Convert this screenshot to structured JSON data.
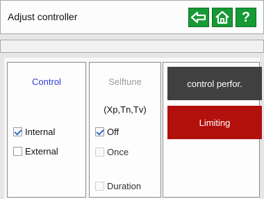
{
  "header": {
    "title": "Adjust controller",
    "buttons": [
      "back-arrow-icon",
      "home-icon",
      "help-icon"
    ],
    "help_glyph": "?"
  },
  "control_panel": {
    "title": "Control",
    "title_color": "#2b3fd6",
    "options": [
      {
        "label": "Internal",
        "checked": true
      },
      {
        "label": "External",
        "checked": false
      }
    ]
  },
  "selftune_panel": {
    "title": "Selftune",
    "subtitle": "(Xp,Tn,Tv)",
    "title_color": "#9c9c9c",
    "options": [
      {
        "label": "Off",
        "checked": true
      },
      {
        "label": "Once",
        "checked": false
      },
      {
        "label": "Duration",
        "checked": false
      }
    ]
  },
  "actions": {
    "control_performance": {
      "label": "control perfor.",
      "color": "#404040"
    },
    "limiting": {
      "label": "Limiting",
      "color": "#b2100c"
    }
  },
  "colors": {
    "nav_green": "#159a34",
    "page_bg": "#e6e6e6"
  }
}
